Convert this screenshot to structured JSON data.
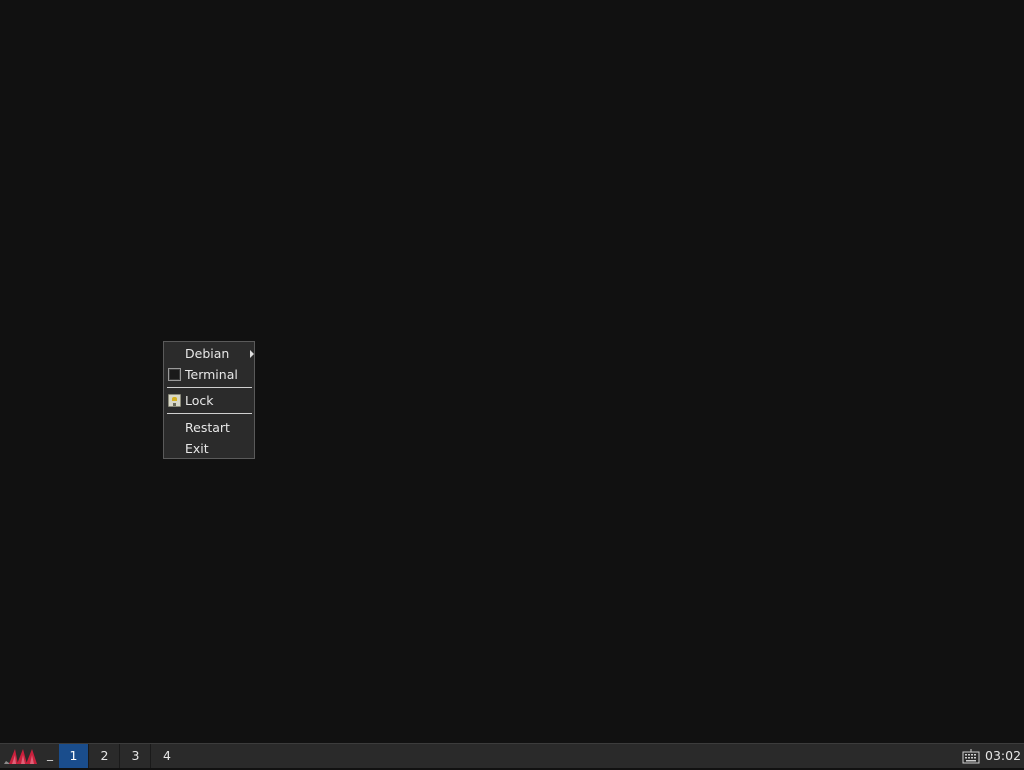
{
  "menu": {
    "items": [
      {
        "label": "Debian",
        "has_submenu": true,
        "icon": null
      },
      {
        "label": "Terminal",
        "icon": "terminal-icon"
      },
      {
        "label": "Lock",
        "icon": "lock-icon"
      },
      {
        "label": "Restart",
        "icon": null
      },
      {
        "label": "Exit",
        "icon": null
      }
    ]
  },
  "taskbar": {
    "start_icon": "jwm-logo-icon",
    "minimized_indicator": "_",
    "workspaces": [
      "1",
      "2",
      "3",
      "4"
    ],
    "active_workspace": "1",
    "tray_icon": "keyboard-icon",
    "clock": "03:02"
  },
  "colors": {
    "desktop": "#111111",
    "menu_bg": "#2b2b2b",
    "taskbar_bg": "#2a2a2a",
    "active_workspace": "#1a4d8c",
    "logo_red": "#c8203c"
  }
}
